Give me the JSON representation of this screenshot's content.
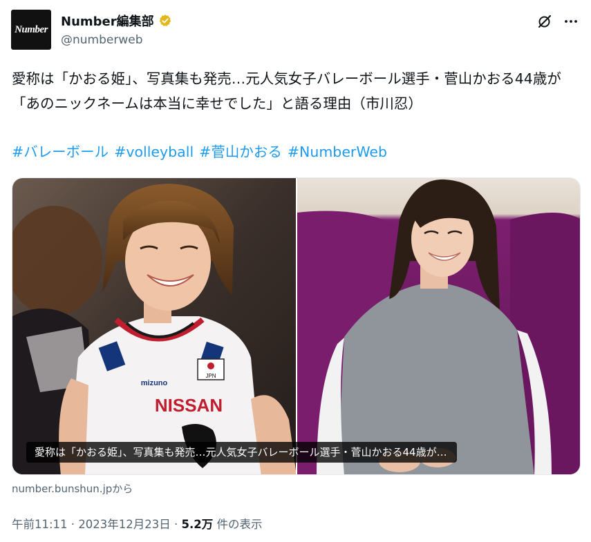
{
  "author": {
    "avatar_text": "Number",
    "display_name": "Number編集部",
    "handle": "@numberweb",
    "verified_color": "#e2b719"
  },
  "tweet": {
    "text": "愛称は「かおる姫」、写真集も発売…元人気女子バレーボール選手・菅山かおる44歳が「あのニックネームは本当に幸せでした」と語る理由（市川忍）",
    "hashtags": [
      "#バレーボール",
      "#volleyball",
      "#菅山かおる",
      "#NumberWeb"
    ]
  },
  "card": {
    "caption": "愛称は「かおる姫」、写真集も発売…元人気女子バレーボール選手・菅山かおる44歳が…",
    "source": "number.bunshun.jpから",
    "left_image": {
      "jersey_sponsor": "NISSAN",
      "jersey_brand": "mizuno",
      "jersey_badge": "JPN"
    }
  },
  "meta": {
    "time": "午前11:11",
    "sep1": " · ",
    "date": "2023年12月23日",
    "sep2": " · ",
    "views": "5.2万",
    "views_label": " 件の表示"
  },
  "icons": [
    "grok-icon",
    "more-icon",
    "verified-badge-icon"
  ],
  "colors": {
    "link": "#1d9bf0",
    "secondary": "#536471",
    "text": "#0f1419",
    "sofa": "#7c1f6f"
  }
}
